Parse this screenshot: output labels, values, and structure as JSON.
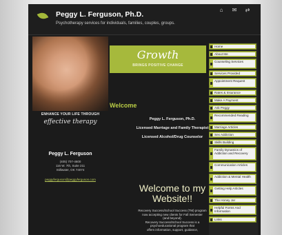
{
  "header": {
    "title": "Peggy L. Ferguson, Ph.D.",
    "tagline": "Psychotherapy services for individuals, families, couples, groups.",
    "icons": [
      "home-icon",
      "mail-icon",
      "share-icon"
    ]
  },
  "banner": {
    "title": "Growth",
    "subtitle": "BRINGS POSITIVE CHANGE"
  },
  "sidebar_left": {
    "enhance": "ENHANCE YOUR LIFE THROUGH",
    "script": "effective therapy",
    "name": "Peggy L. Ferguson",
    "phone": "(405) 707-4600",
    "address1": "116 W. 7th, Suite 211",
    "address2": "Stillwater, OK 74074",
    "email": "peggyferguson@peggyferguson.com"
  },
  "main": {
    "welcome_heading": "Welcome",
    "lines": [
      "Peggy L. Ferguson, Ph.D.",
      "Licensed Marriage and Family Therapist",
      "Licensed Alcohol/Drug Counselor"
    ],
    "big_welcome_1": "Welcome to my",
    "big_welcome_2": "Website!!",
    "promo": [
      "Recovery Success/School Success (TM) program",
      "now accepting new clients for Fall Semester",
      "(and beyond).",
      "Recovery Success/School Success is a",
      "psychoeducational program that",
      "offers information, support, guidance,"
    ]
  },
  "nav": {
    "items": [
      "Home",
      "About Me",
      "Counseling Services",
      "Services Provided",
      "Appointment Request",
      "Rates & Insurance",
      "Make A Payment",
      "Ask Peggy",
      "Recommended Reading",
      "Marriage Articles",
      "Sex Addiction",
      "Skills Building",
      "Family Dynamics of Addiction and Recovery",
      "Communication Articles",
      "Addiction & Mental Health",
      "Getting Help Articles",
      "The Honey Jar",
      "Helpful Forms And Information",
      "Links"
    ]
  },
  "colors": {
    "accent": "#a6b93c",
    "background": "#1b1b1b",
    "nav_item_bg": "#f2f2f2"
  }
}
